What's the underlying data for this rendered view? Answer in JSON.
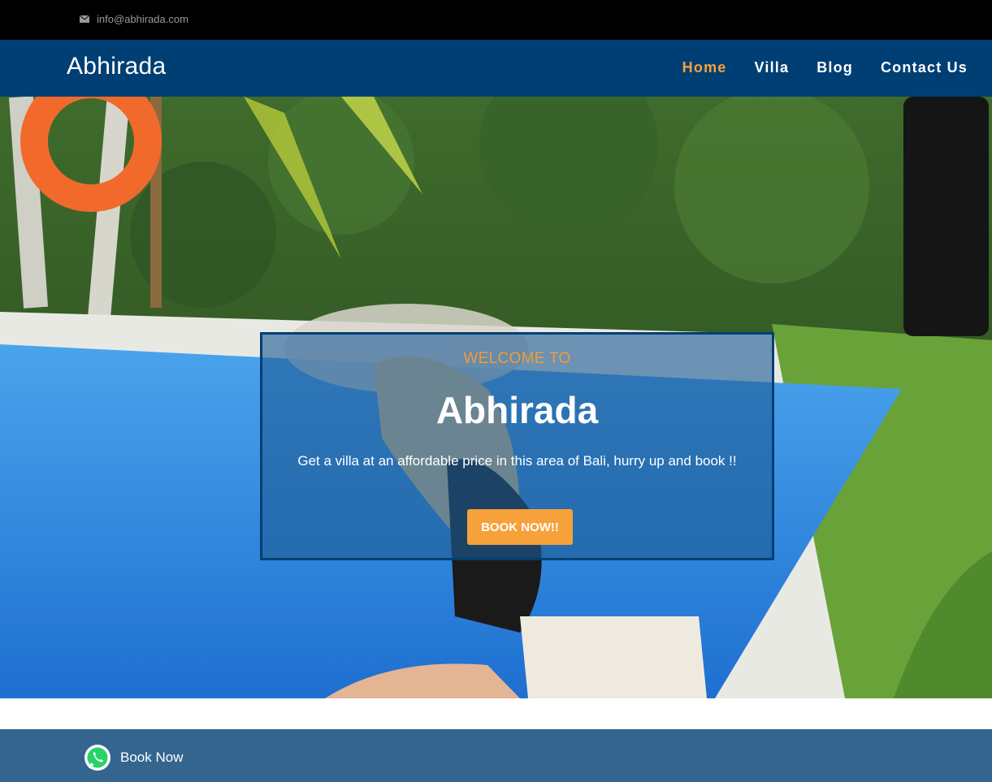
{
  "topbar": {
    "email": "info@abhirada.com",
    "icon": "envelope-icon"
  },
  "header": {
    "logo": "Abhirada",
    "nav": [
      {
        "label": "Home",
        "active": true
      },
      {
        "label": "Villa",
        "active": false
      },
      {
        "label": "Blog",
        "active": false
      },
      {
        "label": "Contact Us",
        "active": false
      }
    ]
  },
  "hero": {
    "subtitle": "WELCOME TO",
    "title": "Abhirada",
    "text": "Get a villa at an affordable price in this area of Bali, hurry up and book !!",
    "button_label": "BOOK NOW!!"
  },
  "footer": {
    "whatsapp_label": "Book Now",
    "icon": "whatsapp-icon"
  },
  "colors": {
    "topbar": "#000000",
    "navbar": "#003f74",
    "accent": "#f7a13b",
    "footer": "#33658f"
  }
}
